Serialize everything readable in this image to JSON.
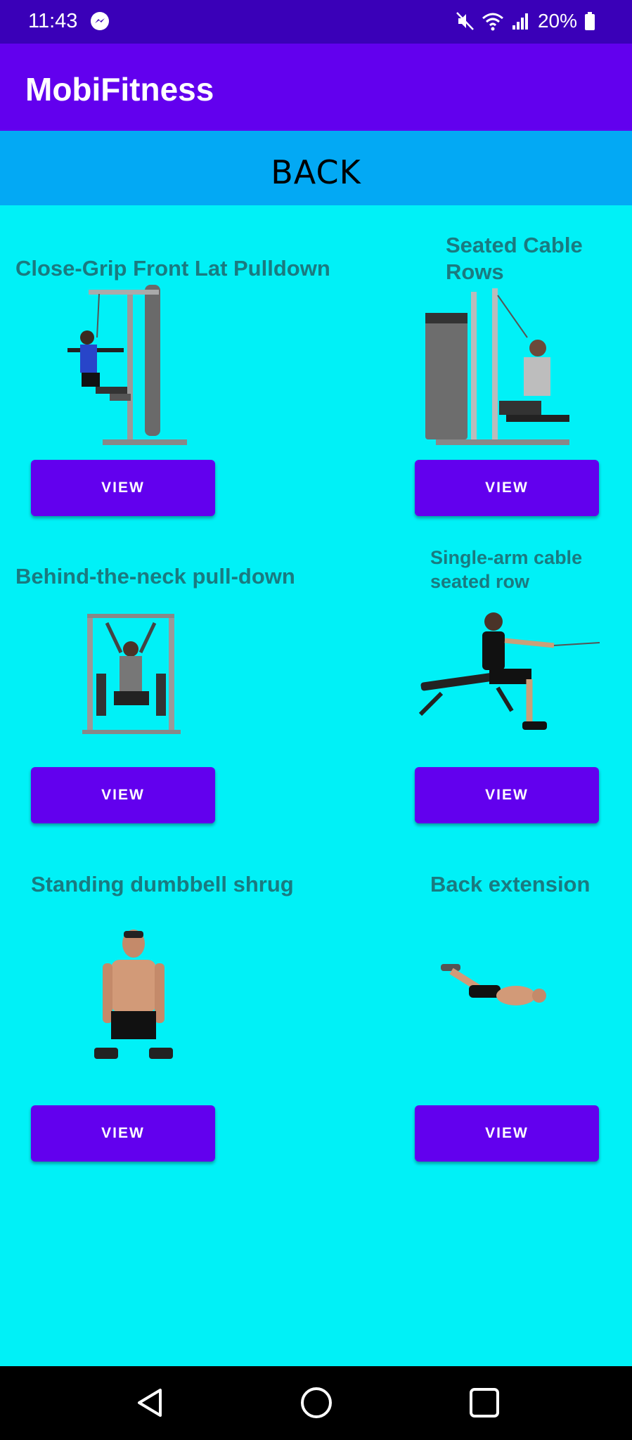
{
  "status": {
    "time": "11:43",
    "battery": "20%",
    "icons": [
      "messenger-icon",
      "mute-icon",
      "wifi-icon",
      "signal-icon",
      "battery-icon"
    ]
  },
  "app": {
    "title": "MobiFitness"
  },
  "back_label": "BACK",
  "exercises": [
    {
      "title": "Close-Grip Front Lat Pulldown",
      "image": "lat-pulldown-machine",
      "button": "VIEW"
    },
    {
      "title": "Seated Cable Rows",
      "image": "seated-cable-row-machine",
      "button": "VIEW"
    },
    {
      "title": "Behind-the-neck pull-down",
      "image": "behind-neck-pulldown-machine",
      "button": "VIEW"
    },
    {
      "title": "Single-arm cable seated row",
      "image": "single-arm-cable-row",
      "button": "VIEW"
    },
    {
      "title": "Standing dumbbell shrug",
      "image": "dumbbell-shrug-man",
      "button": "VIEW"
    },
    {
      "title": "Back extension",
      "image": "back-extension-man",
      "button": "VIEW"
    }
  ],
  "nav": {
    "icons": [
      "back-icon",
      "home-icon",
      "recents-icon"
    ]
  },
  "colors": {
    "background": "#00F1F7",
    "appbar": "#6200EE",
    "statusbar": "#3A00B8",
    "backbar": "#03A9F4",
    "button": "#6200EE",
    "title_text": "#1A7A80"
  }
}
